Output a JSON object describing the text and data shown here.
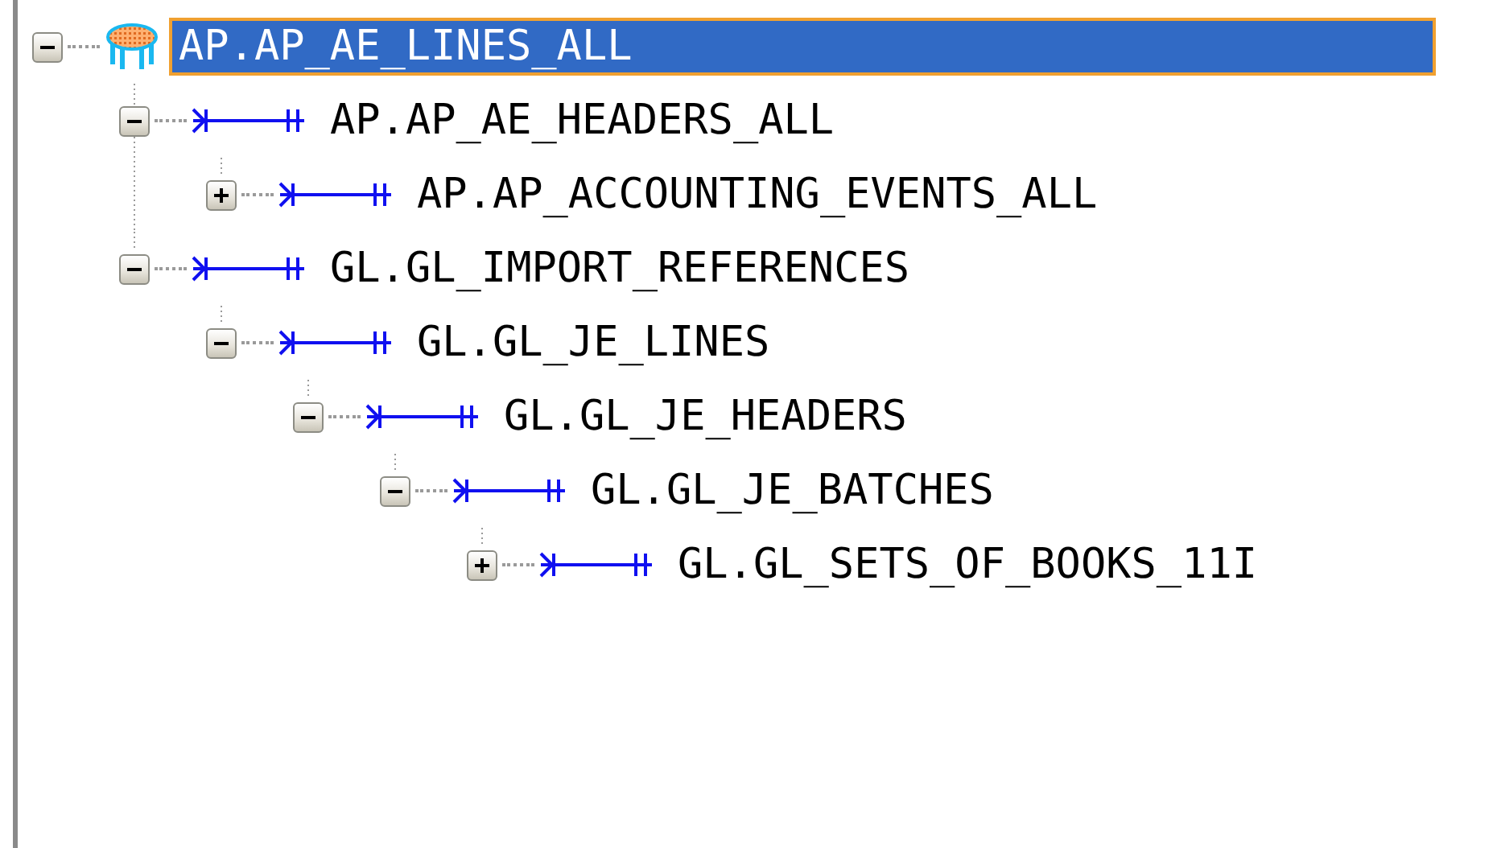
{
  "tree": [
    {
      "label": "AP.AP_AE_LINES_ALL",
      "kind": "table",
      "expanded": true,
      "selected": true,
      "children": [
        {
          "label": "AP.AP_AE_HEADERS_ALL",
          "kind": "relation",
          "expanded": true,
          "selected": false,
          "children": [
            {
              "label": "AP.AP_ACCOUNTING_EVENTS_ALL",
              "kind": "relation",
              "expanded": false,
              "selected": false
            }
          ]
        },
        {
          "label": "GL.GL_IMPORT_REFERENCES",
          "kind": "relation",
          "expanded": true,
          "selected": false,
          "children": [
            {
              "label": "GL.GL_JE_LINES",
              "kind": "relation",
              "expanded": true,
              "selected": false,
              "children": [
                {
                  "label": "GL.GL_JE_HEADERS",
                  "kind": "relation",
                  "expanded": true,
                  "selected": false,
                  "children": [
                    {
                      "label": "GL.GL_JE_BATCHES",
                      "kind": "relation",
                      "expanded": true,
                      "selected": false,
                      "children": [
                        {
                          "label": "GL.GL_SETS_OF_BOOKS_11I",
                          "kind": "relation",
                          "expanded": false,
                          "selected": false
                        }
                      ]
                    }
                  ]
                }
              ]
            }
          ]
        }
      ]
    }
  ]
}
